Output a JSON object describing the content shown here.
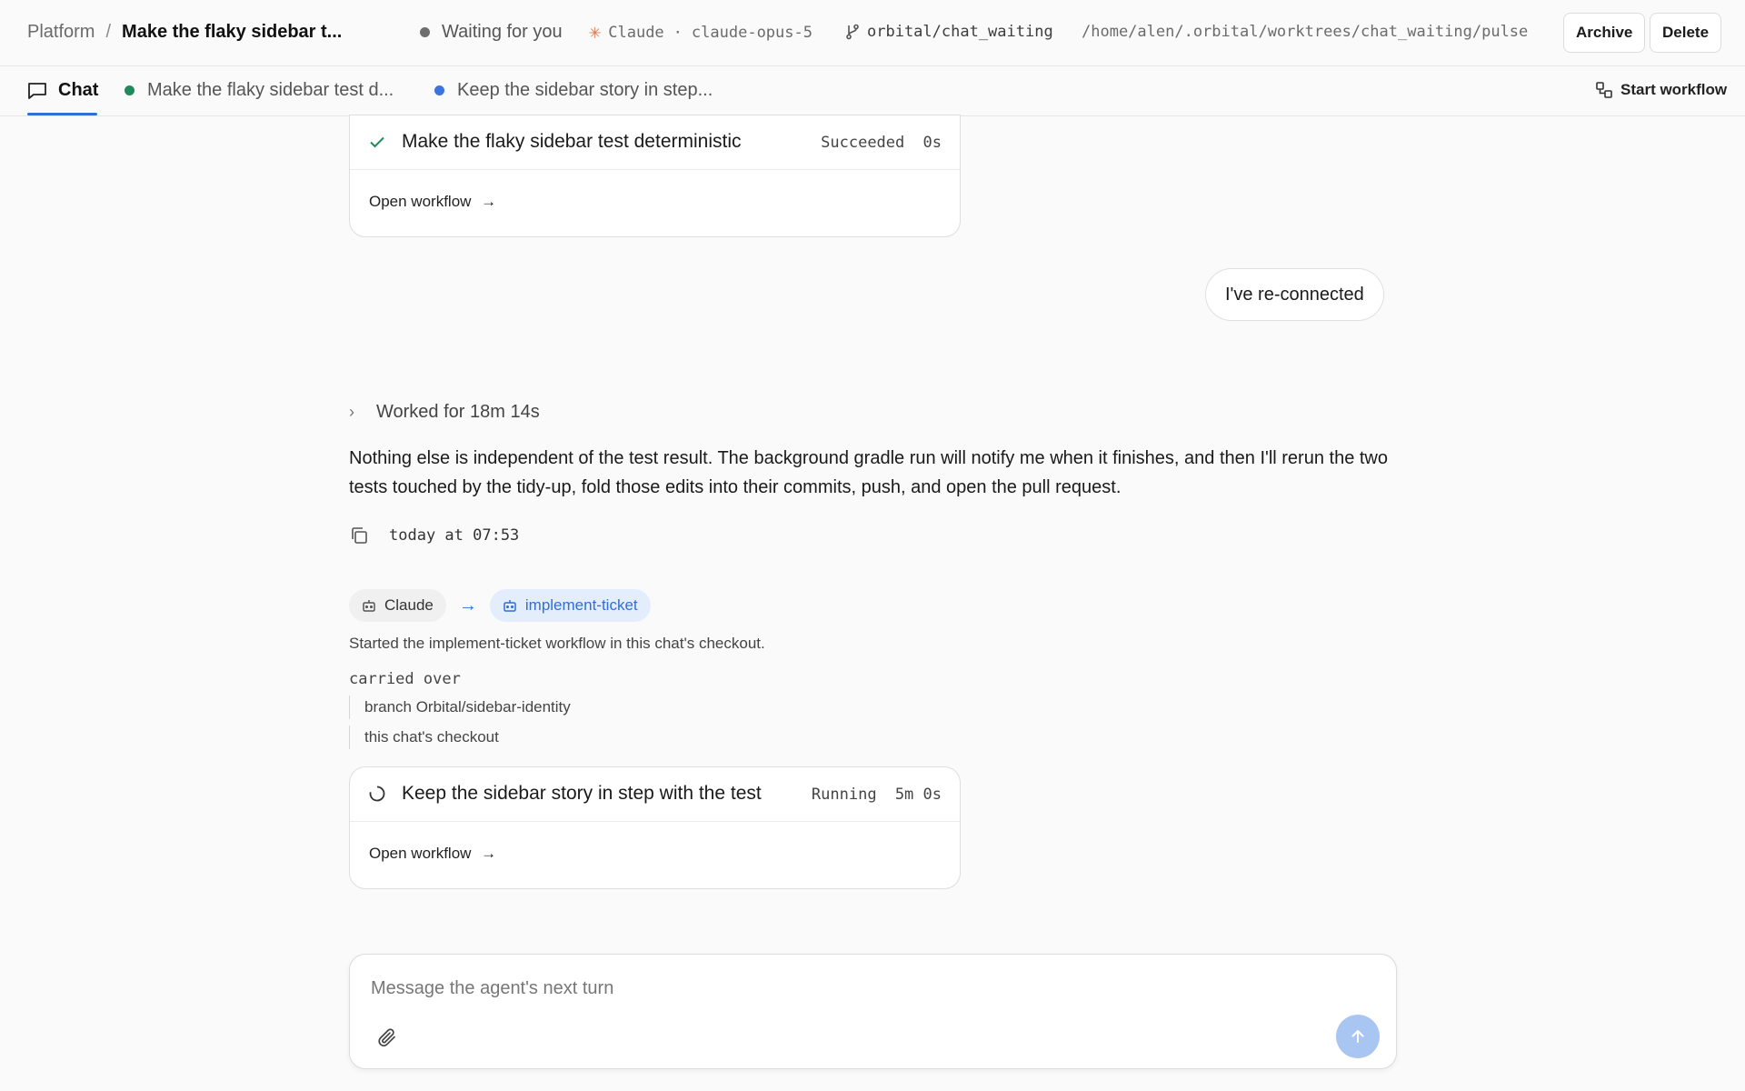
{
  "header": {
    "breadcrumb_root": "Platform",
    "breadcrumb_separator": "/",
    "title": "Make the flaky sidebar t...",
    "status": "Waiting for you",
    "agent_name": "Claude",
    "agent_sep": "·",
    "model": "claude-opus-5",
    "branch": "orbital/chat_waiting",
    "path": "/home/alen/.orbital/worktrees/chat_waiting/pulse",
    "archive_label": "Archive",
    "delete_label": "Delete"
  },
  "tabs": {
    "chat_label": "Chat",
    "items": [
      {
        "label": "Make the flaky sidebar test d...",
        "dot_color": "#1f8a5b"
      },
      {
        "label": "Keep the sidebar story in step...",
        "dot_color": "#3b73e0"
      }
    ],
    "start_workflow_label": "Start workflow"
  },
  "workflow_cards": [
    {
      "name": "Make the flaky sidebar test deterministic",
      "state": "Succeeded",
      "duration": "0s",
      "open_label": "Open workflow",
      "arrow": "→"
    },
    {
      "name": "Keep the sidebar story in step with the test",
      "state": "Running",
      "duration": "5m 0s",
      "open_label": "Open workflow",
      "arrow": "→"
    }
  ],
  "messages": {
    "user_message": "I've re-connected",
    "worked_label": "Worked for 18m 14s",
    "assistant_text": "Nothing else is independent of the test result. The background gradle run will notify me when it finishes, and then I'll rerun the two tests touched by the tidy-up, fold those edits into their commits, push, and open the pull request.",
    "timestamp": "today at 07:53"
  },
  "handoff": {
    "from": "Claude",
    "arrow": "→",
    "to": "implement-ticket",
    "started_text": "Started the implement-ticket workflow in this chat's checkout.",
    "carried_label": "carried over",
    "carried_items": [
      "branch Orbital/sidebar-identity",
      "this chat's checkout"
    ]
  },
  "composer": {
    "placeholder": "Message the agent's next turn"
  },
  "colors": {
    "accent": "#2f6fd6",
    "success": "#1f8a5b",
    "claude_orange": "#d9784f",
    "send_disabled": "#a9c6f2"
  }
}
